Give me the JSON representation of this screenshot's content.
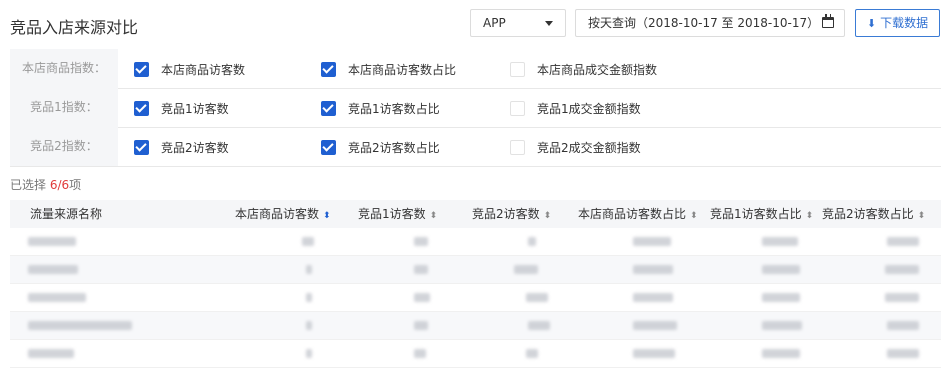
{
  "title": "竞品入店来源对比",
  "platform_select": {
    "value": "APP"
  },
  "date_query": {
    "value": "按天查询（2018-10-17 至 2018-10-17）"
  },
  "download_button": {
    "label": "下载数据"
  },
  "filters": [
    {
      "label": "本店商品指数：",
      "options": [
        {
          "label": "本店商品访客数",
          "checked": true
        },
        {
          "label": "本店商品访客数占比",
          "checked": true
        },
        {
          "label": "本店商品成交金额指数",
          "checked": false
        }
      ]
    },
    {
      "label": "竞品1指数：",
      "options": [
        {
          "label": "竞品1访客数",
          "checked": true
        },
        {
          "label": "竞品1访客数占比",
          "checked": true
        },
        {
          "label": "竞品1成交金额指数",
          "checked": false
        }
      ]
    },
    {
      "label": "竞品2指数：",
      "options": [
        {
          "label": "竞品2访客数",
          "checked": true
        },
        {
          "label": "竞品2访客数占比",
          "checked": true
        },
        {
          "label": "竞品2成交金额指数",
          "checked": false
        }
      ]
    }
  ],
  "selection": {
    "prefix": "已选择",
    "count": "6",
    "total": "/6",
    "suffix": "项"
  },
  "table": {
    "columns": [
      "流量来源名称",
      "本店商品访客数",
      "竞品1访客数",
      "竞品2访客数",
      "本店商品访客数占比",
      "竞品1访客数占比",
      "竞品2访客数占比"
    ],
    "sort_icon": "sort-icon"
  },
  "colors": {
    "accent": "#1f5fd1",
    "highlight": "#e03a3a"
  }
}
